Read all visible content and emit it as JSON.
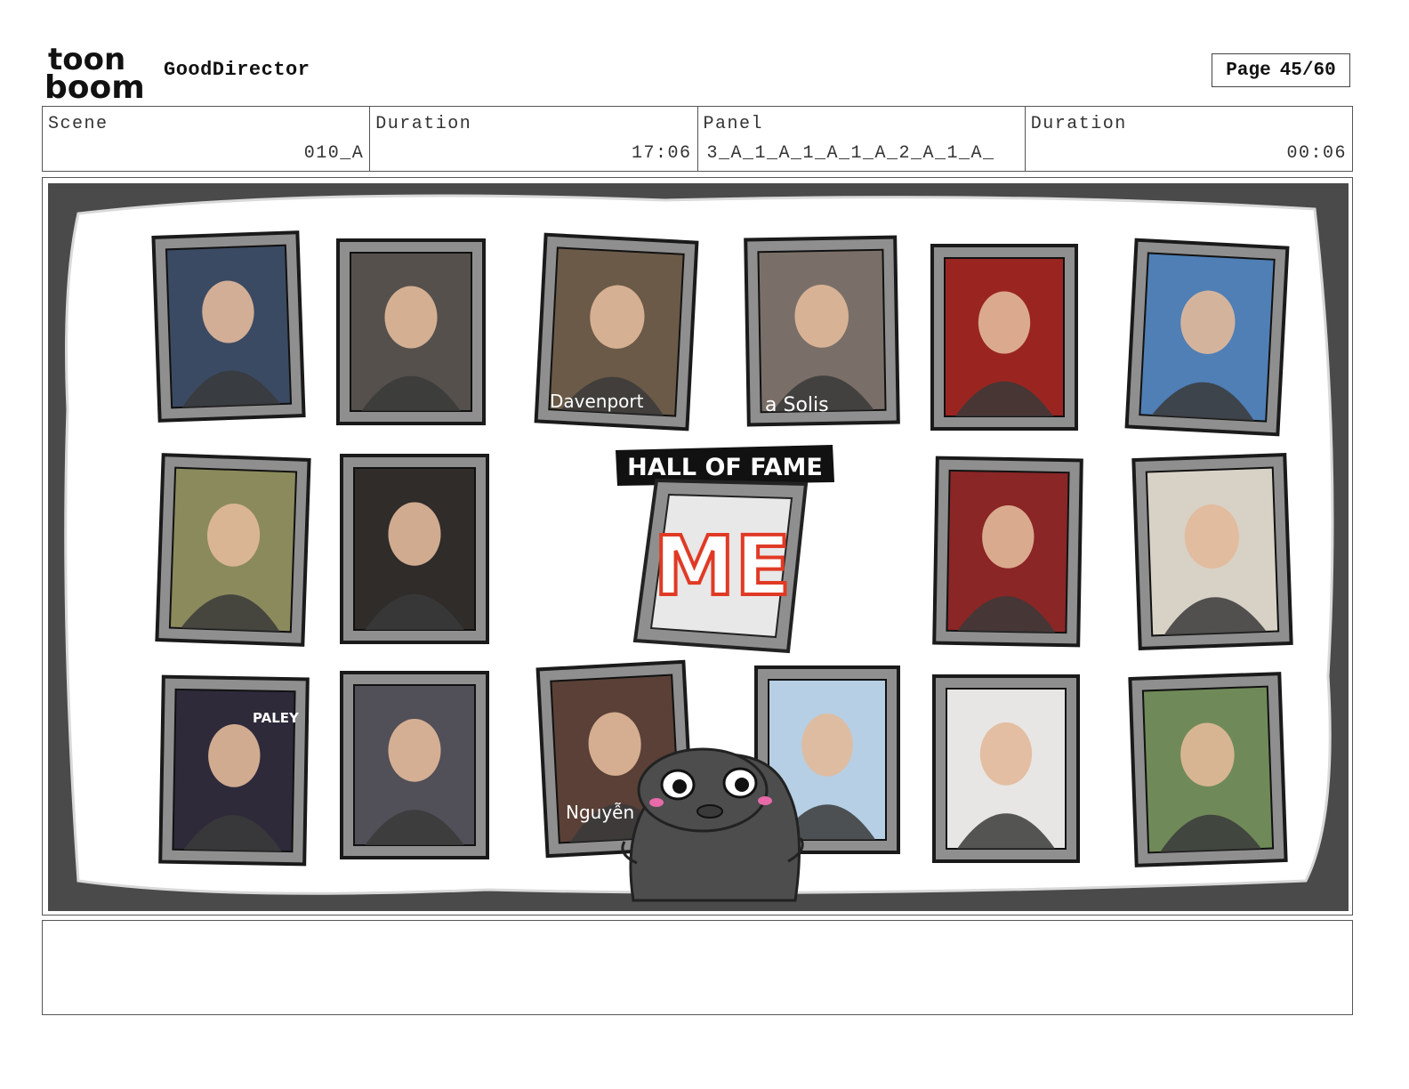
{
  "app": {
    "logo_line1": "toon",
    "logo_line2": "boom",
    "name": "GoodDirector"
  },
  "page": {
    "label": "Page",
    "value": "45/60"
  },
  "info": {
    "scene_label": "Scene",
    "scene_value": "010_A",
    "duration_label": "Duration",
    "duration_value": "17:06",
    "panel_label": "Panel",
    "panel_value": "3_A_1_A_1_A_1_A_2_A_1_A_",
    "panel_duration_label": "Duration",
    "panel_duration_value": "00:06"
  },
  "artwork": {
    "banner_text": "HALL OF FAME",
    "center_frame_text": "ME",
    "caption_davenport": "Davenport",
    "caption_solis": "a Solis",
    "caption_nguyen": "Nguyễn",
    "sign_paley": "PALEY",
    "colors": {
      "wall_border": "#4a4a4a",
      "frame": "#8f8f8f",
      "me_red": "#e03a25"
    }
  },
  "caption_text": ""
}
